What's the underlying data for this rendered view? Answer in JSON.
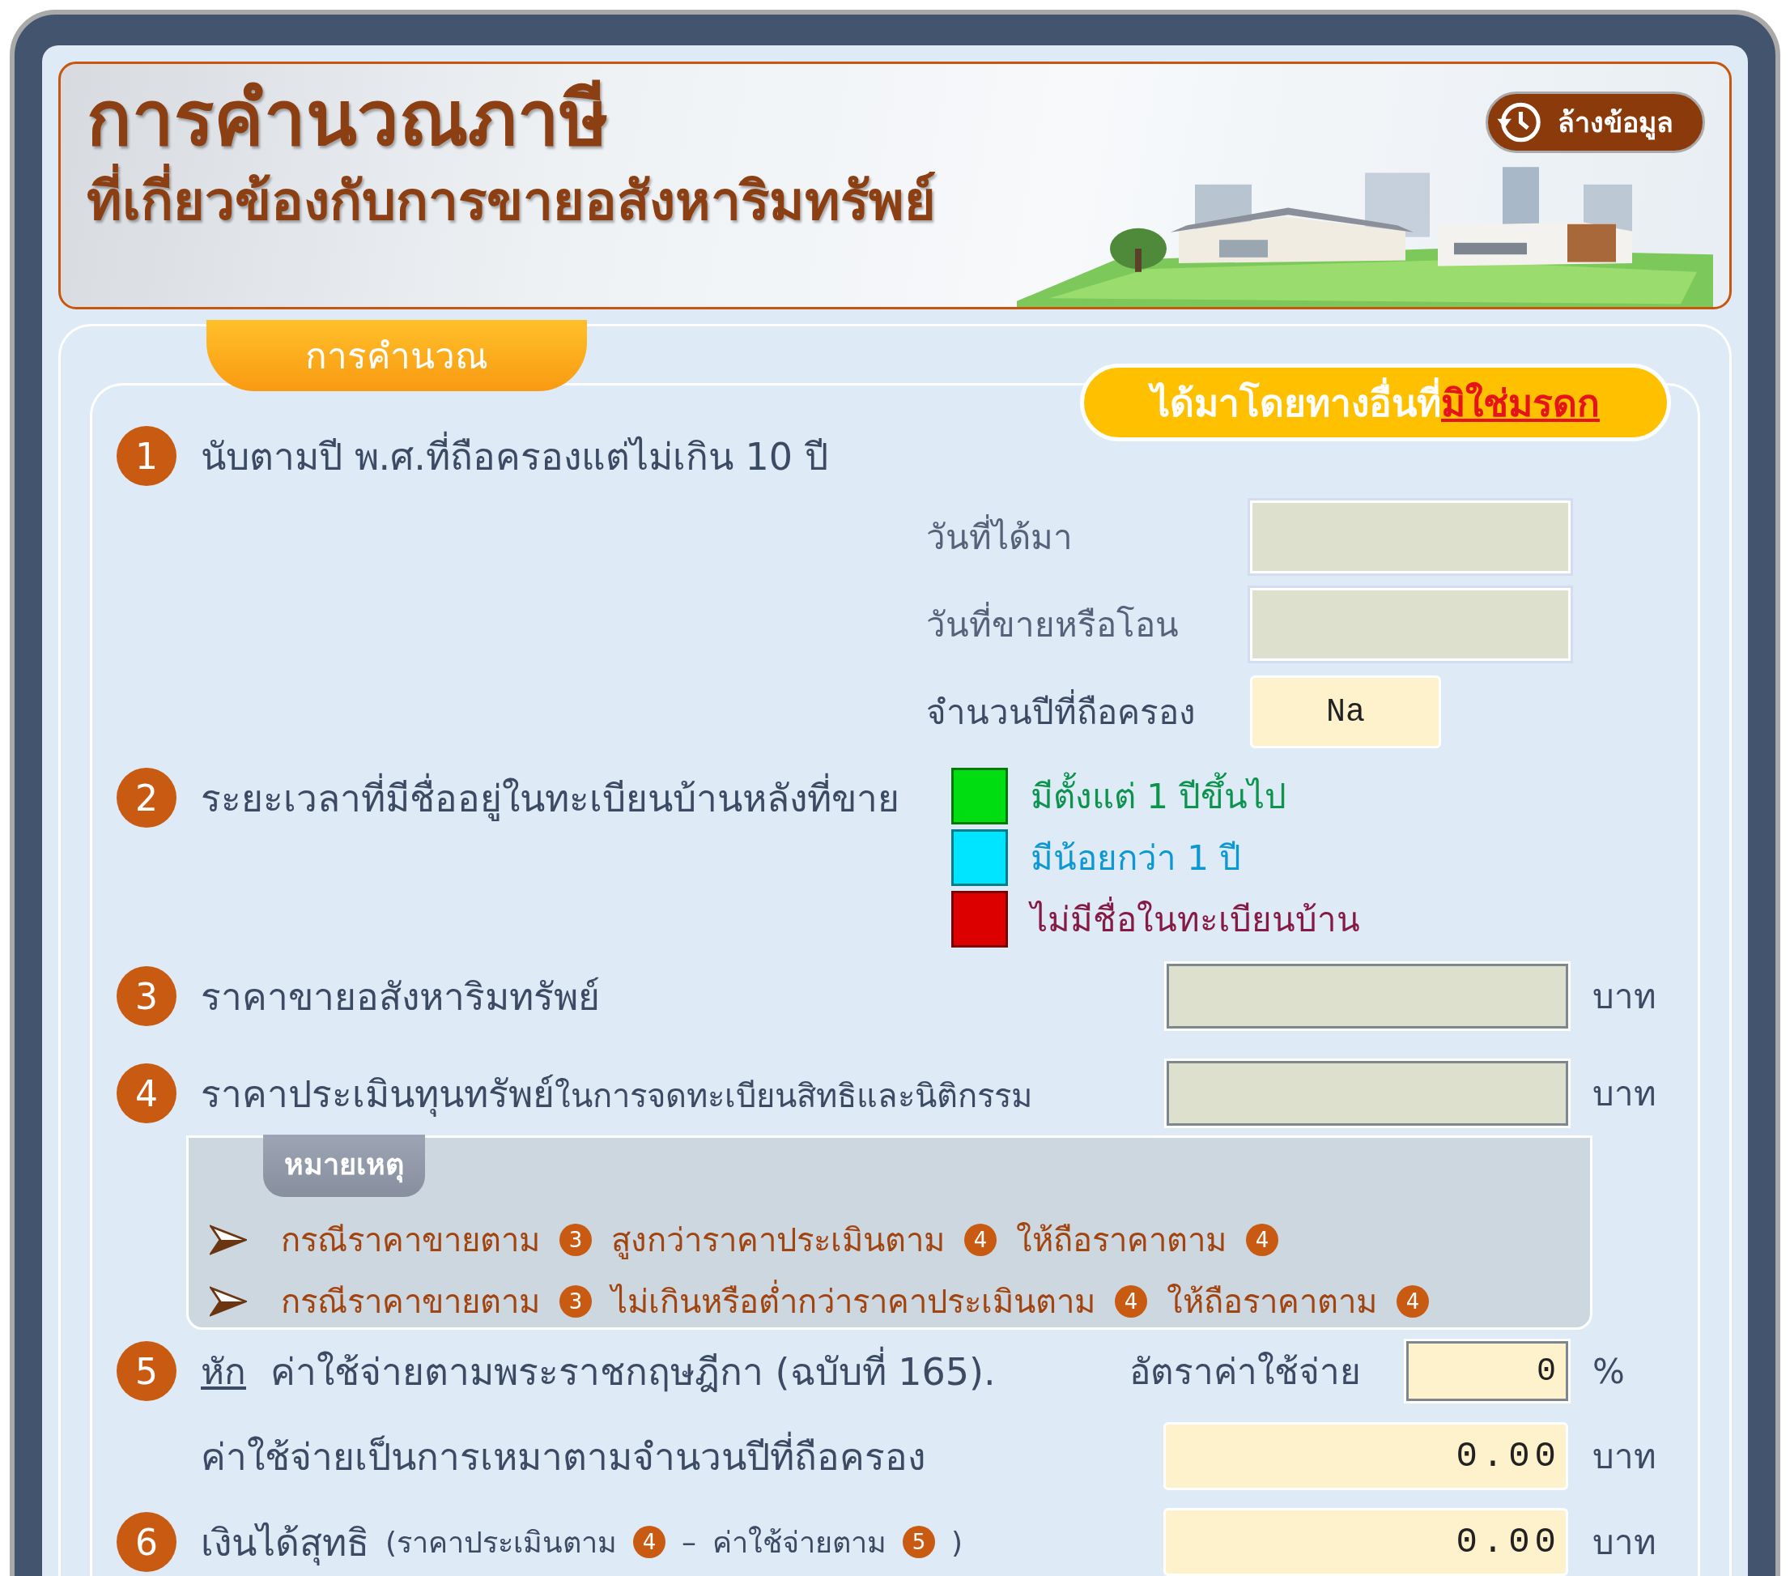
{
  "header": {
    "title": "การคำนวณภาษี",
    "subtitle": "ที่เกี่ยวข้องกับการขายอสังหาริมทรัพย์",
    "clear_button": "ล้างข้อมูล"
  },
  "tab": {
    "label": "การคำนวณ"
  },
  "mode_badge": {
    "text": "ได้มาโดยทางอื่นที่**มิใช่มรดก**"
  },
  "steps": [
    {
      "kind": "holding",
      "number": "1",
      "label": "นับตามปี พ.ศ.ที่ถือครองแต่ไม่เกิน 10 ปี",
      "fields": [
        {
          "kind": "input",
          "label": "วันที่ได้มา"
        },
        {
          "kind": "input",
          "label": "วันที่ขายหรือโอน"
        },
        {
          "kind": "output",
          "label": "จำนวนปีที่ถือครอง",
          "value": "Na"
        }
      ]
    },
    {
      "kind": "options",
      "number": "2",
      "label": "ระยะเวลาที่มีชื่ออยู่ในทะเบียนบ้านหลังที่ขาย",
      "options": [
        {
          "label": "มีตั้งแต่ 1 ปีขึ้นไป",
          "color": "#00dd11"
        },
        {
          "label": "มีน้อยกว่า 1 ปี",
          "color": "#00e5ff"
        },
        {
          "label": "ไม่มีชื่อในทะเบียนบ้าน",
          "color": "#dd0000"
        }
      ]
    },
    {
      "kind": "amount",
      "number": "3",
      "label": "ราคาขายอสังหาริมทรัพย์",
      "unit": "บาท"
    },
    {
      "kind": "amount",
      "number": "4",
      "label": "ราคาประเมินทุนทรัพย์",
      "label_note": "ในการจดทะเบียนสิทธิและนิติกรรม",
      "unit": "บาท"
    },
    {
      "kind": "notes",
      "title": "หมายเหตุ",
      "lines": [
        {
          "parts": [
            {
              "kind": "text",
              "text": "กรณีราคาขายตาม"
            },
            {
              "kind": "ref",
              "text": "3"
            },
            {
              "kind": "text",
              "text": "สูงกว่าราคาประเมินตาม"
            },
            {
              "kind": "ref",
              "text": "4"
            },
            {
              "kind": "text",
              "text": "ให้ถือราคาตาม"
            },
            {
              "kind": "ref",
              "text": "4"
            }
          ]
        },
        {
          "parts": [
            {
              "kind": "text",
              "text": "กรณีราคาขายตาม"
            },
            {
              "kind": "ref",
              "text": "3"
            },
            {
              "kind": "text",
              "text": "ไม่เกินหรือต่ำกว่าราคาประเมินตาม"
            },
            {
              "kind": "ref",
              "text": "4"
            },
            {
              "kind": "text",
              "text": "ให้ถือราคาตาม"
            },
            {
              "kind": "ref",
              "text": "4"
            }
          ]
        }
      ]
    },
    {
      "kind": "expense",
      "number": "5",
      "deduct_word": "หัก",
      "label": "ค่าใช้จ่ายตามพระราชกฤษฎีกา (ฉบับที่ 165).",
      "rate_label": "อัตราค่าใช้จ่าย",
      "rate_value": "0",
      "rate_unit": "%",
      "sub_label": "ค่าใช้จ่ายเป็นการเหมาตามจำนวนปีที่ถือครอง",
      "sub_value": "0.00",
      "unit": "บาท"
    },
    {
      "kind": "net",
      "number": "6",
      "label": "เงินได้สุทธิ",
      "formula": [
        {
          "kind": "text",
          "text": "(ราคาประเมินตาม"
        },
        {
          "kind": "ref",
          "text": "4"
        },
        {
          "kind": "text",
          "text": "–"
        },
        {
          "kind": "text",
          "text": "ค่าใช้จ่ายตาม"
        },
        {
          "kind": "ref",
          "text": "5"
        },
        {
          "kind": "text",
          "text": ")"
        }
      ],
      "value": "0.00",
      "unit": "บาท"
    }
  ]
}
